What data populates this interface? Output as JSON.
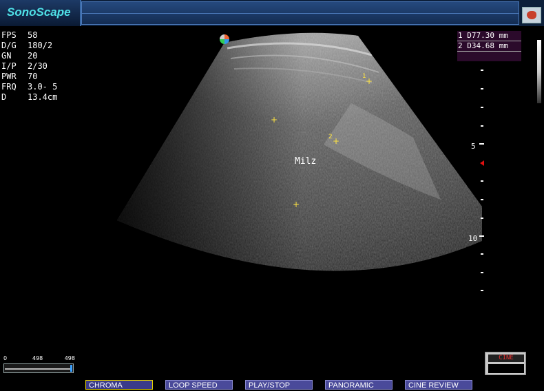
{
  "app": {
    "logo_text": "SonoScape"
  },
  "params": [
    {
      "key": "FPS",
      "value": "58"
    },
    {
      "key": "D/G",
      "value": "180/2"
    },
    {
      "key": "GN",
      "value": "20"
    },
    {
      "key": "I/P",
      "value": "2/30"
    },
    {
      "key": "PWR",
      "value": "70"
    },
    {
      "key": "FRQ",
      "value": "3.0- 5"
    },
    {
      "key": "D",
      "value": "13.4cm"
    }
  ],
  "measurements": [
    {
      "text": "1 D77.30 mm"
    },
    {
      "text": "2 D34.68 mm"
    }
  ],
  "depth_scale": {
    "labels": [
      "5",
      "10"
    ]
  },
  "image": {
    "organ_label": "Milz",
    "cursor_symbol": "+",
    "cursor_labels": [
      "1",
      "2"
    ]
  },
  "cine": {
    "bar_labels": {
      "start": "0",
      "current": "498",
      "end": "498"
    },
    "box_label": "CINE"
  },
  "softkeys": [
    {
      "label": "CHROMA",
      "active": true
    },
    {
      "label": "LOOP SPEED",
      "active": false
    },
    {
      "label": "PLAY/STOP",
      "active": false
    },
    {
      "label": "PANORAMIC",
      "active": false
    },
    {
      "label": "CINE REVIEW",
      "active": false
    }
  ],
  "colors": {
    "cursor": "#ffe440",
    "measurement_bg": "#2b0a2b",
    "focus_marker": "#e01010",
    "softkey_bg": "#4a4a9a"
  }
}
